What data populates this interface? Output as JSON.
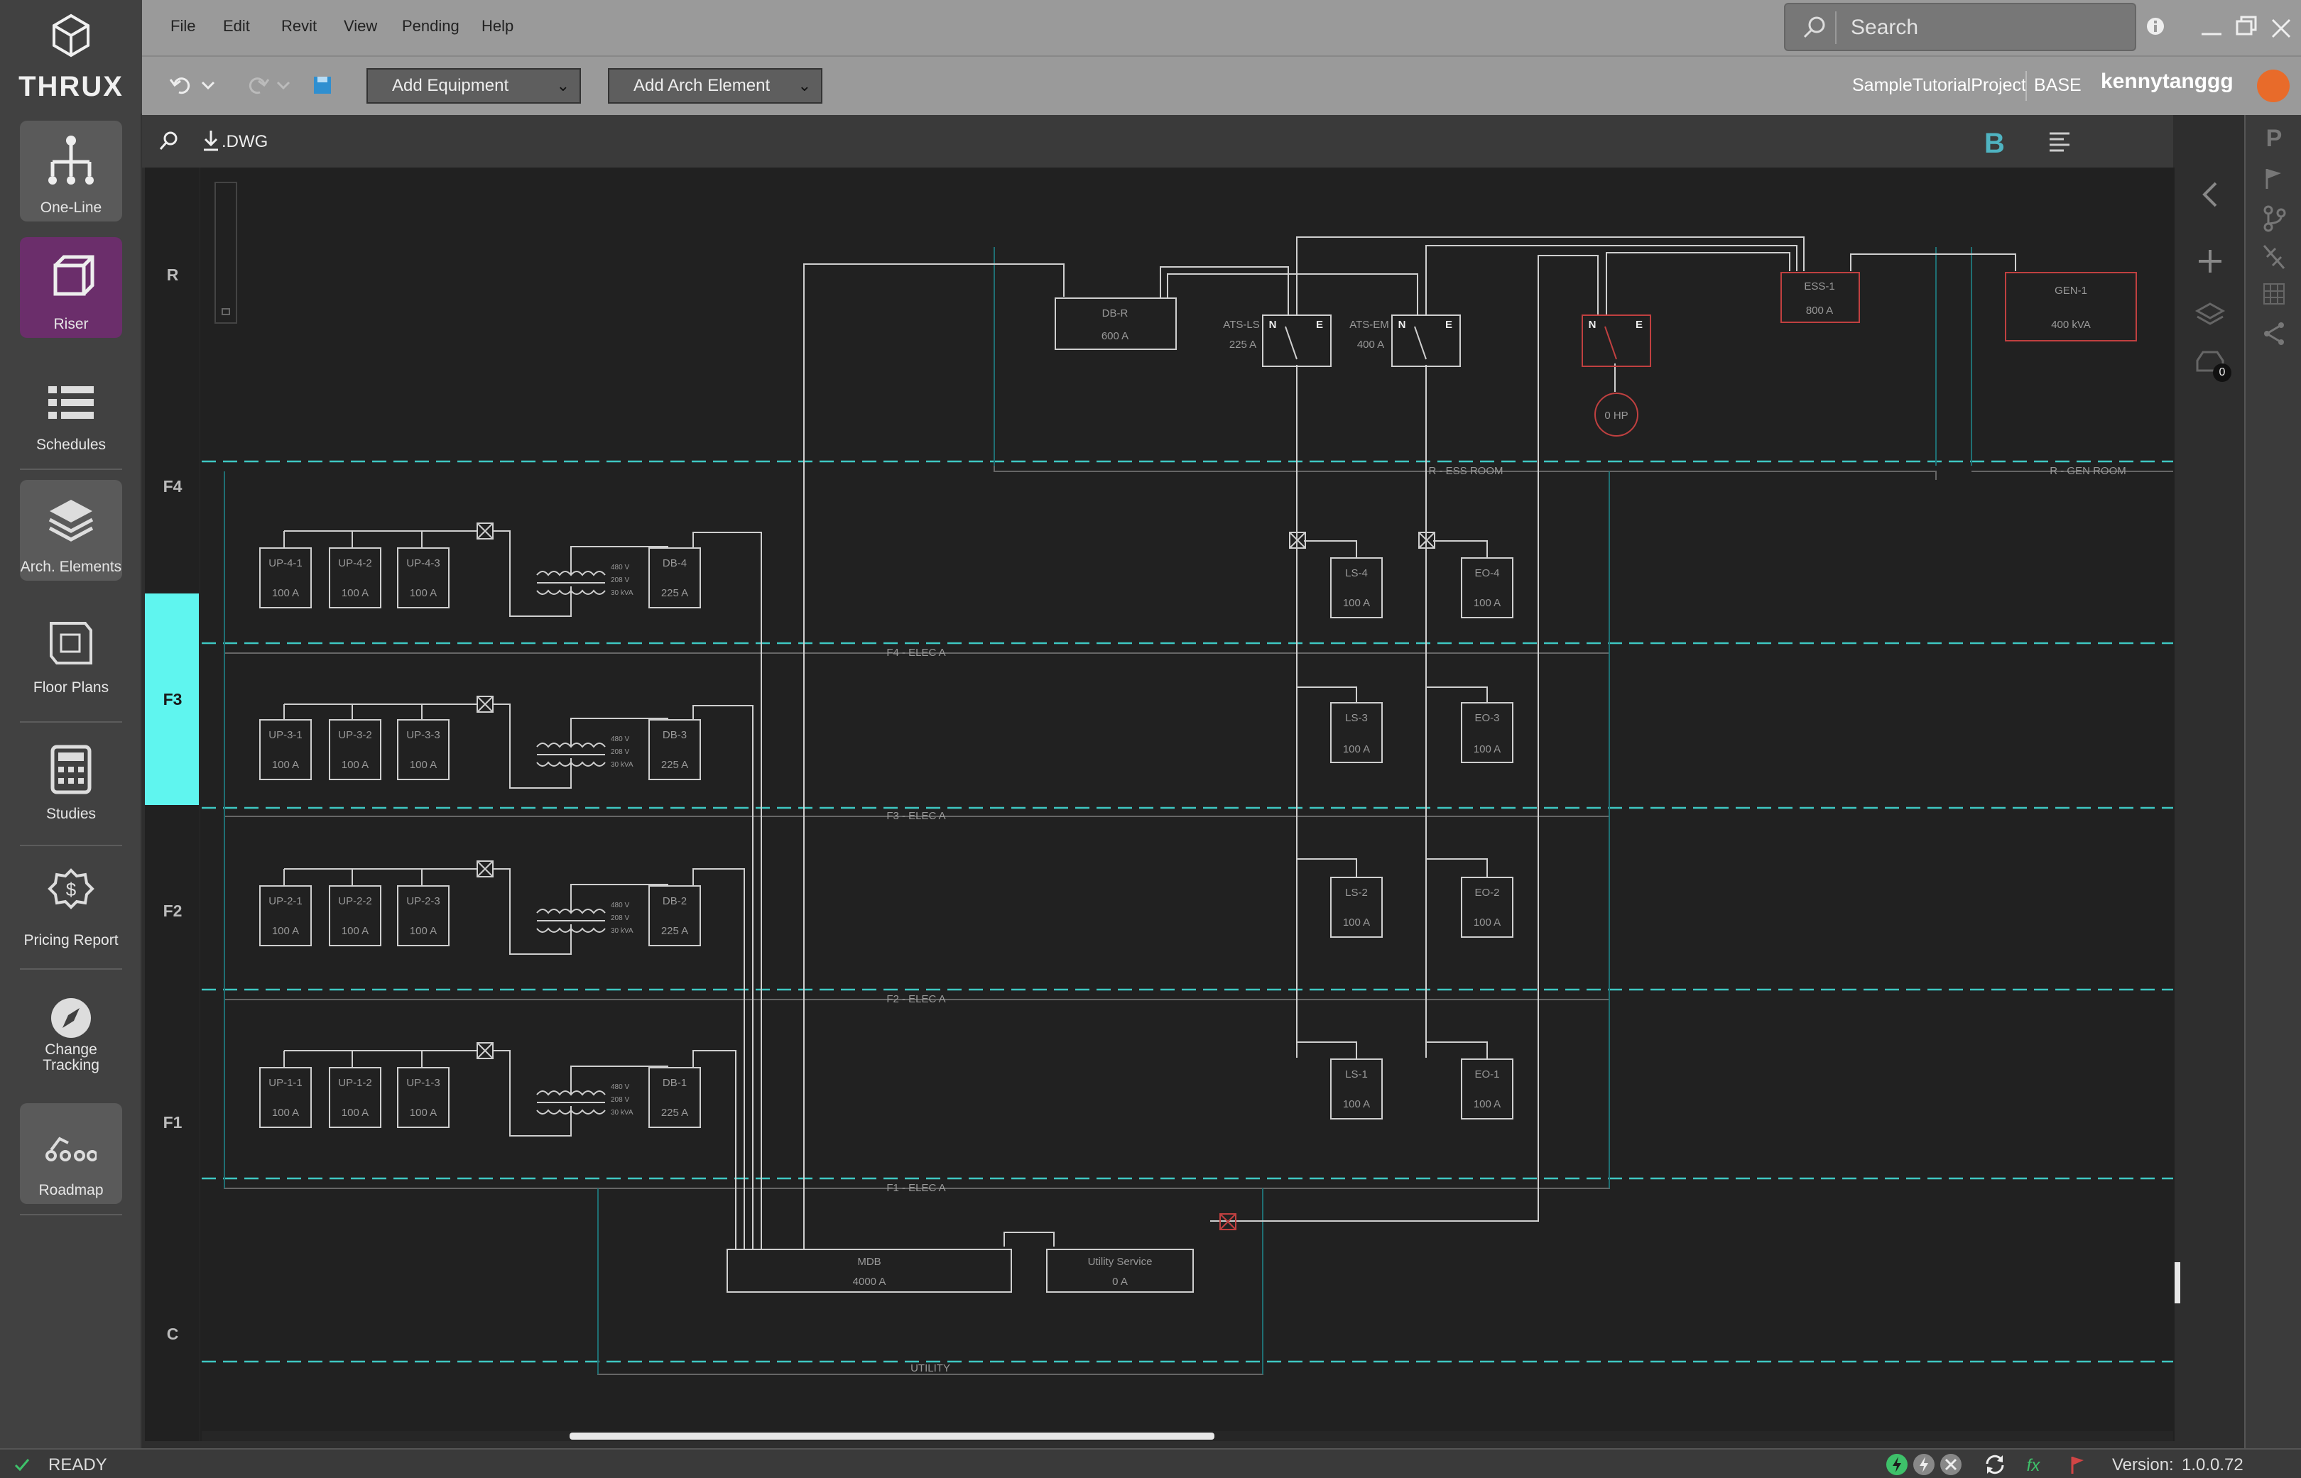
{
  "app": {
    "brand": "THRUX"
  },
  "sidebar": {
    "items": [
      {
        "label": "One-Line",
        "icon": "one-line-icon"
      },
      {
        "label": "Riser",
        "icon": "riser-cube-icon"
      },
      {
        "label": "Schedules",
        "icon": "schedules-list-icon"
      },
      {
        "label": "Arch. Elements",
        "icon": "layers-stack-icon"
      },
      {
        "label": "Floor Plans",
        "icon": "floor-plan-map-icon"
      },
      {
        "label": "Studies",
        "icon": "calculator-icon"
      },
      {
        "label": "Pricing Report",
        "icon": "pricing-badge-icon"
      },
      {
        "label": "Change\nTracking",
        "icon": "compass-icon"
      },
      {
        "label": "Roadmap",
        "icon": "roadmap-icon"
      }
    ]
  },
  "menubar": {
    "menus": [
      "File",
      "Edit",
      "Revit",
      "View",
      "Pending",
      "Help"
    ]
  },
  "toolbar": {
    "add_equipment": "Add Equipment",
    "add_arch_element": "Add Arch Element"
  },
  "search": {
    "placeholder": "Search"
  },
  "header": {
    "project": "SampleTutorialProject",
    "branch": "BASE",
    "user": "kennytanggg"
  },
  "canvasbar": {
    "dwg_label": ".DWG",
    "bold_label": "B"
  },
  "levels": [
    "R",
    "F4",
    "F3",
    "F2",
    "F1",
    "C"
  ],
  "active_level": "F3",
  "rooms": {
    "ess": "R - ESS ROOM",
    "gen": "R - GEN ROOM",
    "f4": "F4 - ELEC A",
    "f3": "F3 - ELEC A",
    "f2": "F2 - ELEC A",
    "f1": "F1 - ELEC A",
    "utility": "UTILITY"
  },
  "equipment": {
    "dbr": {
      "name": "DB-R",
      "rating": "600 A"
    },
    "atsls": {
      "name": "ATS-LS",
      "rating": "225 A"
    },
    "atsem": {
      "name": "ATS-EM",
      "rating": "400 A"
    },
    "ess1": {
      "name": "ESS-1",
      "rating": "800 A"
    },
    "gen1": {
      "name": "GEN-1",
      "rating": "400 kVA"
    },
    "motor": {
      "name": "0 HP"
    },
    "mdb": {
      "name": "MDB",
      "rating": "4000 A"
    },
    "utility_service": {
      "name": "Utility Service",
      "rating": "0 A"
    },
    "ats_n": "N",
    "ats_e": "E",
    "floors": [
      {
        "up": [
          "UP-4-1",
          "UP-4-2",
          "UP-4-3"
        ],
        "db": "DB-4",
        "ls": "LS-4",
        "eo": "EO-4"
      },
      {
        "up": [
          "UP-3-1",
          "UP-3-2",
          "UP-3-3"
        ],
        "db": "DB-3",
        "ls": "LS-3",
        "eo": "EO-3"
      },
      {
        "up": [
          "UP-2-1",
          "UP-2-2",
          "UP-2-3"
        ],
        "db": "DB-2",
        "ls": "LS-2",
        "eo": "EO-2"
      },
      {
        "up": [
          "UP-1-1",
          "UP-1-2",
          "UP-1-3"
        ],
        "db": "DB-1",
        "ls": "LS-1",
        "eo": "EO-1"
      }
    ],
    "up_rating": "100 A",
    "db_rating": "225 A",
    "panel_rating": "100 A",
    "xfmr_primary": "480 V",
    "xfmr_secondary": "208 V",
    "xfmr_size": "30 kVA"
  },
  "rightpanel": {
    "badge_count": "0"
  },
  "status": {
    "state": "READY",
    "version_label": "Version:",
    "version": "1.0.0.72"
  },
  "colors": {
    "accent": "#5ff5ef",
    "riser_active": "#6b2e6b",
    "dashed_level": "#3ec7c2",
    "fault": "#c04040"
  }
}
